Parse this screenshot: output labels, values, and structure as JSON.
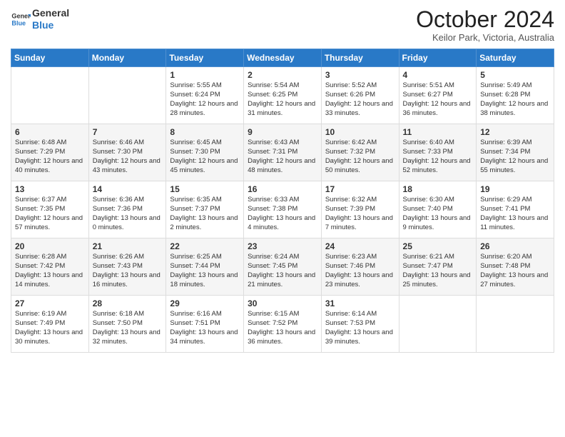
{
  "header": {
    "logo_line1": "General",
    "logo_line2": "Blue",
    "month_title": "October 2024",
    "location": "Keilor Park, Victoria, Australia"
  },
  "weekdays": [
    "Sunday",
    "Monday",
    "Tuesday",
    "Wednesday",
    "Thursday",
    "Friday",
    "Saturday"
  ],
  "weeks": [
    [
      {
        "day": "",
        "sunrise": "",
        "sunset": "",
        "daylight": ""
      },
      {
        "day": "",
        "sunrise": "",
        "sunset": "",
        "daylight": ""
      },
      {
        "day": "1",
        "sunrise": "Sunrise: 5:55 AM",
        "sunset": "Sunset: 6:24 PM",
        "daylight": "Daylight: 12 hours and 28 minutes."
      },
      {
        "day": "2",
        "sunrise": "Sunrise: 5:54 AM",
        "sunset": "Sunset: 6:25 PM",
        "daylight": "Daylight: 12 hours and 31 minutes."
      },
      {
        "day": "3",
        "sunrise": "Sunrise: 5:52 AM",
        "sunset": "Sunset: 6:26 PM",
        "daylight": "Daylight: 12 hours and 33 minutes."
      },
      {
        "day": "4",
        "sunrise": "Sunrise: 5:51 AM",
        "sunset": "Sunset: 6:27 PM",
        "daylight": "Daylight: 12 hours and 36 minutes."
      },
      {
        "day": "5",
        "sunrise": "Sunrise: 5:49 AM",
        "sunset": "Sunset: 6:28 PM",
        "daylight": "Daylight: 12 hours and 38 minutes."
      }
    ],
    [
      {
        "day": "6",
        "sunrise": "Sunrise: 6:48 AM",
        "sunset": "Sunset: 7:29 PM",
        "daylight": "Daylight: 12 hours and 40 minutes."
      },
      {
        "day": "7",
        "sunrise": "Sunrise: 6:46 AM",
        "sunset": "Sunset: 7:30 PM",
        "daylight": "Daylight: 12 hours and 43 minutes."
      },
      {
        "day": "8",
        "sunrise": "Sunrise: 6:45 AM",
        "sunset": "Sunset: 7:30 PM",
        "daylight": "Daylight: 12 hours and 45 minutes."
      },
      {
        "day": "9",
        "sunrise": "Sunrise: 6:43 AM",
        "sunset": "Sunset: 7:31 PM",
        "daylight": "Daylight: 12 hours and 48 minutes."
      },
      {
        "day": "10",
        "sunrise": "Sunrise: 6:42 AM",
        "sunset": "Sunset: 7:32 PM",
        "daylight": "Daylight: 12 hours and 50 minutes."
      },
      {
        "day": "11",
        "sunrise": "Sunrise: 6:40 AM",
        "sunset": "Sunset: 7:33 PM",
        "daylight": "Daylight: 12 hours and 52 minutes."
      },
      {
        "day": "12",
        "sunrise": "Sunrise: 6:39 AM",
        "sunset": "Sunset: 7:34 PM",
        "daylight": "Daylight: 12 hours and 55 minutes."
      }
    ],
    [
      {
        "day": "13",
        "sunrise": "Sunrise: 6:37 AM",
        "sunset": "Sunset: 7:35 PM",
        "daylight": "Daylight: 12 hours and 57 minutes."
      },
      {
        "day": "14",
        "sunrise": "Sunrise: 6:36 AM",
        "sunset": "Sunset: 7:36 PM",
        "daylight": "Daylight: 13 hours and 0 minutes."
      },
      {
        "day": "15",
        "sunrise": "Sunrise: 6:35 AM",
        "sunset": "Sunset: 7:37 PM",
        "daylight": "Daylight: 13 hours and 2 minutes."
      },
      {
        "day": "16",
        "sunrise": "Sunrise: 6:33 AM",
        "sunset": "Sunset: 7:38 PM",
        "daylight": "Daylight: 13 hours and 4 minutes."
      },
      {
        "day": "17",
        "sunrise": "Sunrise: 6:32 AM",
        "sunset": "Sunset: 7:39 PM",
        "daylight": "Daylight: 13 hours and 7 minutes."
      },
      {
        "day": "18",
        "sunrise": "Sunrise: 6:30 AM",
        "sunset": "Sunset: 7:40 PM",
        "daylight": "Daylight: 13 hours and 9 minutes."
      },
      {
        "day": "19",
        "sunrise": "Sunrise: 6:29 AM",
        "sunset": "Sunset: 7:41 PM",
        "daylight": "Daylight: 13 hours and 11 minutes."
      }
    ],
    [
      {
        "day": "20",
        "sunrise": "Sunrise: 6:28 AM",
        "sunset": "Sunset: 7:42 PM",
        "daylight": "Daylight: 13 hours and 14 minutes."
      },
      {
        "day": "21",
        "sunrise": "Sunrise: 6:26 AM",
        "sunset": "Sunset: 7:43 PM",
        "daylight": "Daylight: 13 hours and 16 minutes."
      },
      {
        "day": "22",
        "sunrise": "Sunrise: 6:25 AM",
        "sunset": "Sunset: 7:44 PM",
        "daylight": "Daylight: 13 hours and 18 minutes."
      },
      {
        "day": "23",
        "sunrise": "Sunrise: 6:24 AM",
        "sunset": "Sunset: 7:45 PM",
        "daylight": "Daylight: 13 hours and 21 minutes."
      },
      {
        "day": "24",
        "sunrise": "Sunrise: 6:23 AM",
        "sunset": "Sunset: 7:46 PM",
        "daylight": "Daylight: 13 hours and 23 minutes."
      },
      {
        "day": "25",
        "sunrise": "Sunrise: 6:21 AM",
        "sunset": "Sunset: 7:47 PM",
        "daylight": "Daylight: 13 hours and 25 minutes."
      },
      {
        "day": "26",
        "sunrise": "Sunrise: 6:20 AM",
        "sunset": "Sunset: 7:48 PM",
        "daylight": "Daylight: 13 hours and 27 minutes."
      }
    ],
    [
      {
        "day": "27",
        "sunrise": "Sunrise: 6:19 AM",
        "sunset": "Sunset: 7:49 PM",
        "daylight": "Daylight: 13 hours and 30 minutes."
      },
      {
        "day": "28",
        "sunrise": "Sunrise: 6:18 AM",
        "sunset": "Sunset: 7:50 PM",
        "daylight": "Daylight: 13 hours and 32 minutes."
      },
      {
        "day": "29",
        "sunrise": "Sunrise: 6:16 AM",
        "sunset": "Sunset: 7:51 PM",
        "daylight": "Daylight: 13 hours and 34 minutes."
      },
      {
        "day": "30",
        "sunrise": "Sunrise: 6:15 AM",
        "sunset": "Sunset: 7:52 PM",
        "daylight": "Daylight: 13 hours and 36 minutes."
      },
      {
        "day": "31",
        "sunrise": "Sunrise: 6:14 AM",
        "sunset": "Sunset: 7:53 PM",
        "daylight": "Daylight: 13 hours and 39 minutes."
      },
      {
        "day": "",
        "sunrise": "",
        "sunset": "",
        "daylight": ""
      },
      {
        "day": "",
        "sunrise": "",
        "sunset": "",
        "daylight": ""
      }
    ]
  ]
}
